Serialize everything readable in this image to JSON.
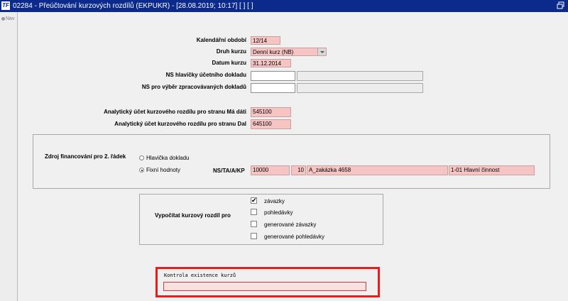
{
  "window": {
    "icon_text": "TF",
    "title": "02284 - Přeúčtování kurzových rozdílů (EKPUKR) - [28.08.2019; 10:17]  [ ]  [ ]",
    "restore_icon": "restore-window-icon"
  },
  "sidebar": {
    "nav_label": "Nav"
  },
  "form": {
    "period_label": "Kalendářní období",
    "period_value": "12/14",
    "rate_type_label": "Druh kurzu",
    "rate_type_value": "Denní kurz (NB)",
    "rate_date_label": "Datum kurzu",
    "rate_date_value": "31.12.2014",
    "ns_header_label": "NS hlavičky účetního dokladu",
    "ns_header_code": "",
    "ns_header_name": "",
    "ns_select_label": "NS pro výběr zpracovávaných dokladů",
    "ns_select_code": "",
    "ns_select_name": "",
    "acct_debit_label": "Analytický účet kurzového rozdílu pro stranu Má dáti",
    "acct_debit_value": "545100",
    "acct_credit_label": "Analytický účet kurzového rozdílu pro stranu Dal",
    "acct_credit_value": "645100"
  },
  "funding": {
    "label": "Zdroj financování pro 2. řádek",
    "option_header": "Hlavička dokladu",
    "option_fixed": "Fixní hodnoty",
    "selected": "Fixní hodnoty",
    "ns_label": "NS/TA/A/KP",
    "ns_value": "10000",
    "ta_value": "10",
    "a_value": "A_zakázka 4658",
    "kp_value": "1-01 Hlavní činnost"
  },
  "compute": {
    "label": "Vypočítat kurzový rozdíl pro",
    "options": [
      {
        "label": "závazky",
        "checked": true
      },
      {
        "label": "pohledávky",
        "checked": false
      },
      {
        "label": "generované závazky",
        "checked": false
      },
      {
        "label": "generované pohledávky",
        "checked": false
      }
    ]
  },
  "control": {
    "label": "Kontrola existence kurzů",
    "value": ""
  },
  "colors": {
    "titlebar": "#0b2a8c",
    "required_field": "#f7c4c4",
    "highlight_border": "#e61e1e"
  }
}
